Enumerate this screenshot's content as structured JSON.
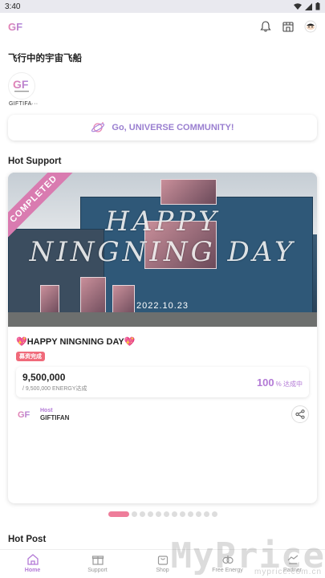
{
  "status_bar": {
    "time": "3:40"
  },
  "appbar": {
    "logo_text": "GF",
    "icons": [
      "bell-icon",
      "store-icon",
      "avatar-icon"
    ]
  },
  "channel": {
    "title": "飞行中的宇宙飞船",
    "logo_label": "GIFTIFA···"
  },
  "community_button": {
    "label": "Go, UNIVERSE COMMUNITY!"
  },
  "hot_support": {
    "section_title": "Hot Support",
    "card": {
      "ribbon": "COMPLETED",
      "overlay_text": "HAPPY NINGNING DAY",
      "overlay_date": "2022.10.23",
      "title": "💖HAPPY NINGNING DAY💖",
      "status_pill": "募资完成",
      "energy_amount": "9,500,000",
      "energy_target": "/ 9,500,000 ENERGY达成",
      "percent_value": "100",
      "percent_suffix": "% 达成中",
      "host_label": "Host",
      "host_name": "GIFTIFAN"
    }
  },
  "pager": {
    "total": 12,
    "active_index": 0
  },
  "hot_post": {
    "section_title": "Hot Post"
  },
  "bottom_nav": {
    "items": [
      {
        "label": "Home",
        "icon": "home-icon",
        "active": true
      },
      {
        "label": "Support",
        "icon": "gift-icon",
        "active": false
      },
      {
        "label": "Shop",
        "icon": "shop-bag-icon",
        "active": false
      },
      {
        "label": "Free Energy",
        "icon": "energy-icon",
        "active": false
      },
      {
        "label": "Partner",
        "icon": "partner-icon",
        "active": false
      }
    ]
  },
  "watermark": {
    "text": "MyPrice",
    "sub": "myprice.com.cn"
  },
  "colors": {
    "accent": "#b37ad6",
    "pink": "#ee7d9a",
    "ribbon": "#d97bb0",
    "pill": "#f06a7a"
  }
}
